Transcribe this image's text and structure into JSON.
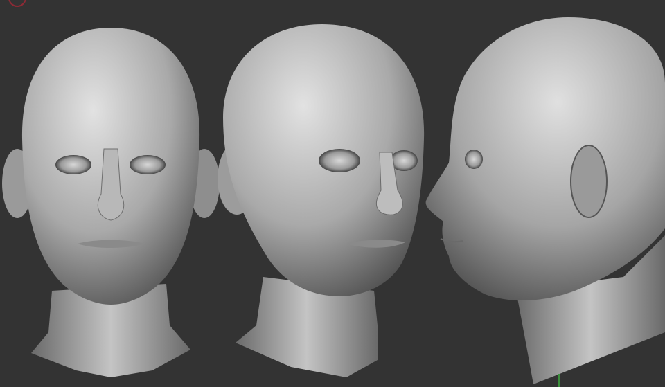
{
  "viewport": {
    "background_color": "#333333",
    "model_color": "#b4b4b4",
    "gizmo_color": "#8c2a35",
    "axis_color": "#3c8f3c"
  },
  "views": [
    {
      "name": "front"
    },
    {
      "name": "three-quarter"
    },
    {
      "name": "profile"
    }
  ],
  "icons": [
    "rotation-gizmo-icon",
    "y-axis-line-icon"
  ]
}
